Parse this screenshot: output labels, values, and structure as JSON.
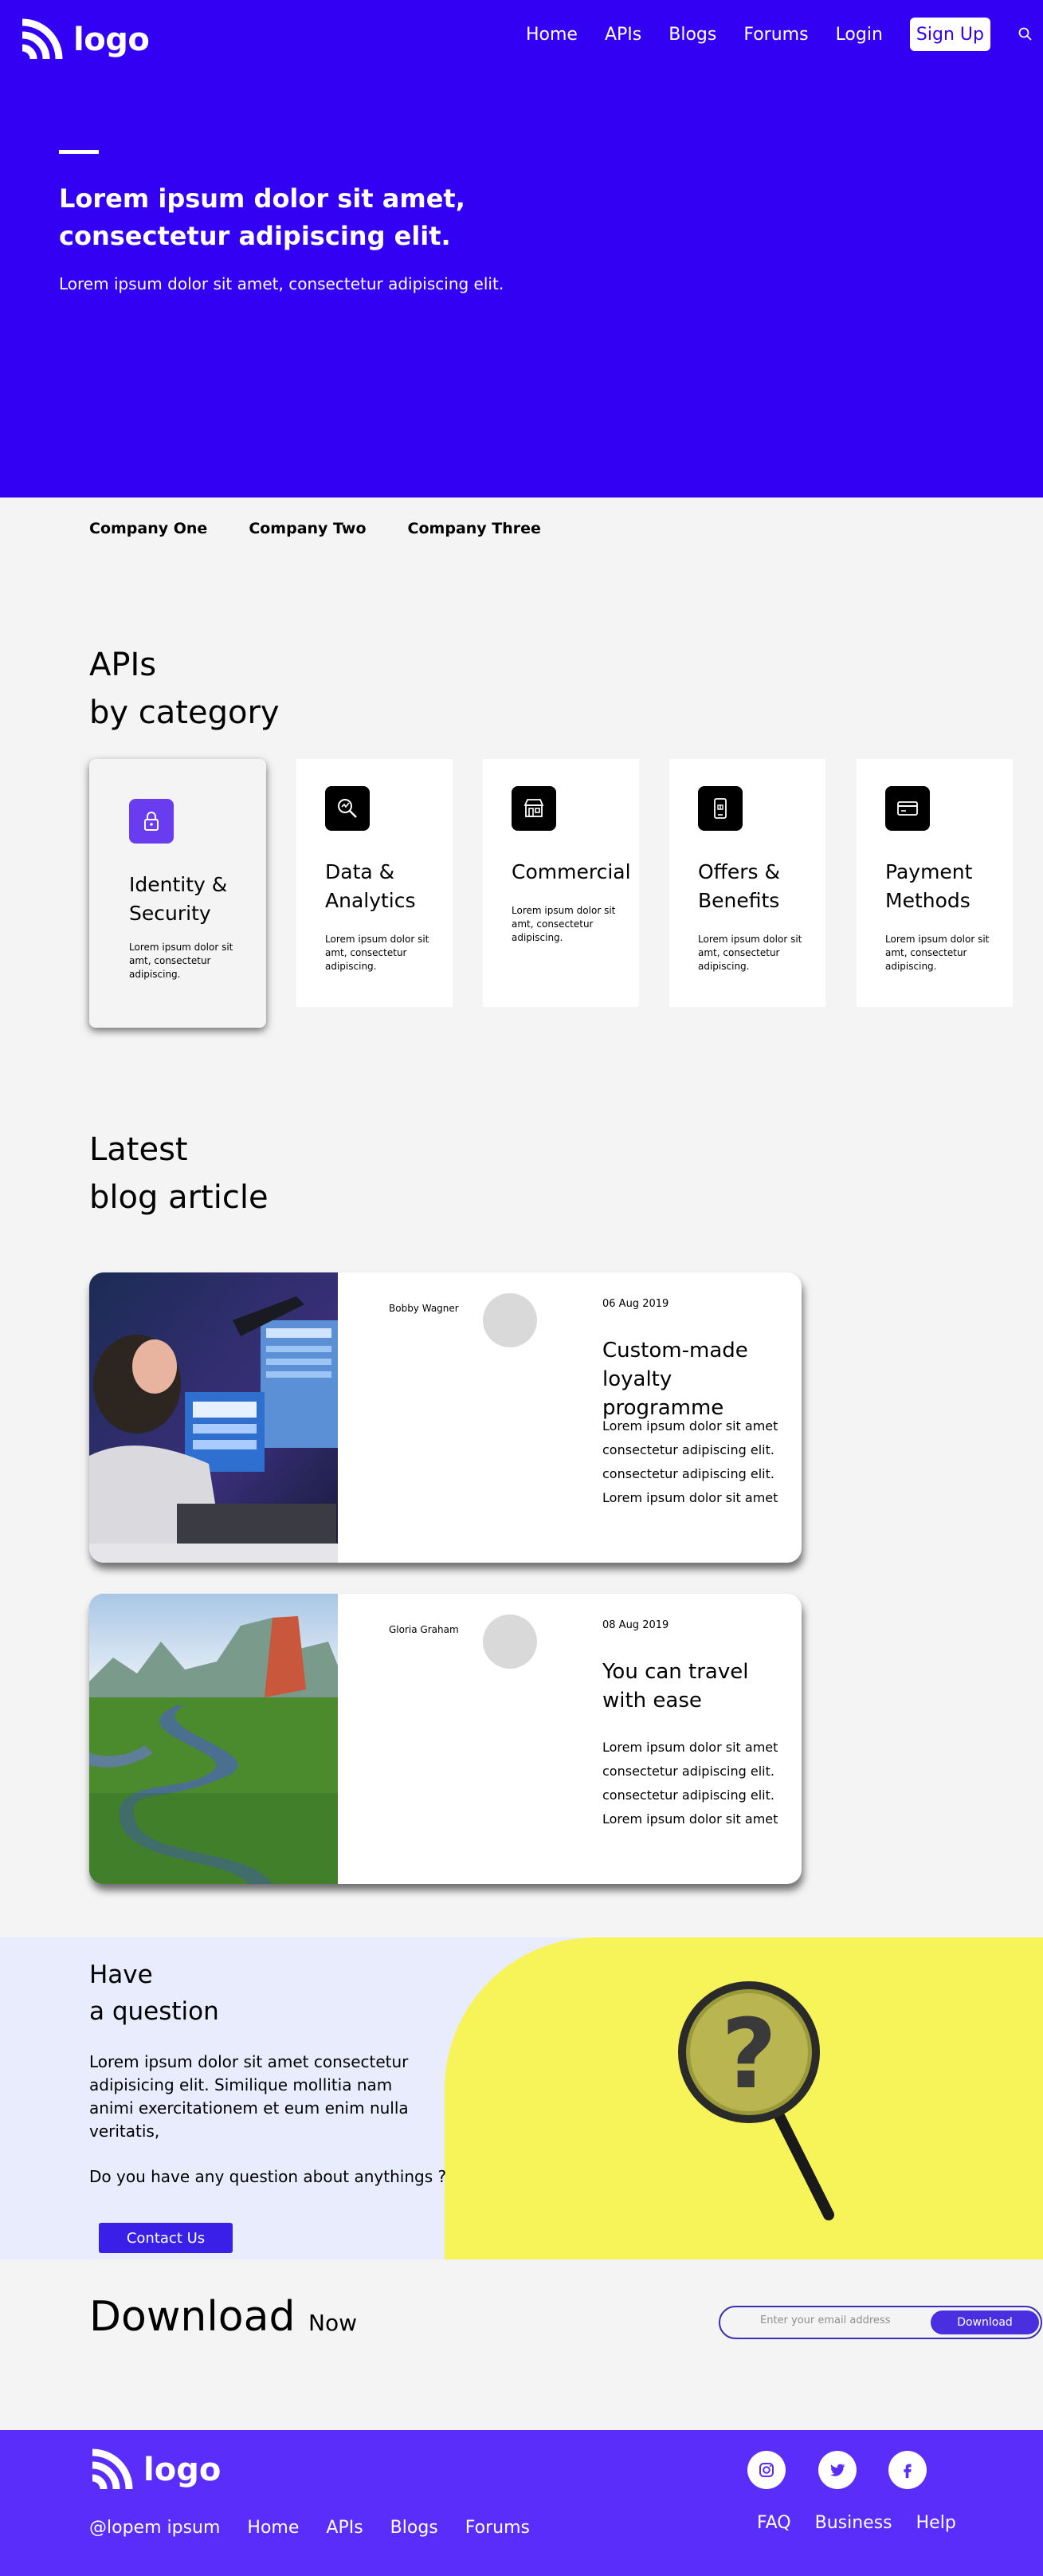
{
  "header": {
    "logo_text": "logo",
    "nav": [
      "Home",
      "APIs",
      "Blogs",
      "Forums",
      "Login"
    ],
    "signup_label": "Sign Up",
    "search_icon": "search-icon"
  },
  "hero": {
    "title": "Lorem ipsum dolor sit amet, consectetur adipiscing elit.",
    "subtitle": "Lorem ipsum dolor sit amet, consectetur adipiscing elit.",
    "background": "#3300f4"
  },
  "companies": [
    "Company One",
    "Company Two",
    "Company Three"
  ],
  "apis": {
    "title_line1": "APIs",
    "title_line2": "by category",
    "cards": [
      {
        "icon": "lock-icon",
        "title": "Identity & Security",
        "desc": "Lorem ipsum dolor sit amt, consectetur adipiscing."
      },
      {
        "icon": "analytics-icon",
        "title": "Data & Analytics",
        "desc": "Lorem ipsum dolor sit amt, consectetur adipiscing."
      },
      {
        "icon": "store-icon",
        "title": "Commercial",
        "desc": "Lorem ipsum dolor sit amt, consectetur adipiscing."
      },
      {
        "icon": "mobile-offer-icon",
        "title": "Offers & Benefits",
        "desc": "Lorem ipsum dolor sit amt, consectetur adipiscing."
      },
      {
        "icon": "credit-card-icon",
        "title": "Payment Methods",
        "desc": "Lorem ipsum dolor sit amt, consectetur adipiscing."
      }
    ]
  },
  "blog": {
    "title_line1": "Latest",
    "title_line2": "blog article",
    "articles": [
      {
        "author": "Bobby Wagner",
        "date": "06 Aug 2019",
        "title": "Custom-made loyalty programme",
        "body": "Lorem ipsum dolor sit amet consectetur adipiscing elit. consectetur adipiscing elit. Lorem ipsum dolor sit amet",
        "image": "person at computer screens"
      },
      {
        "author": "Gloria Graham",
        "date": "08 Aug 2019",
        "title": "You can travel with ease",
        "body": "Lorem ipsum dolor sit amet consectetur adipiscing elit. consectetur adipiscing elit. Lorem ipsum dolor sit amet",
        "image": "winding river through forest"
      }
    ]
  },
  "question": {
    "title_line1": "Have",
    "title_line2": "a question",
    "body": "Lorem ipsum dolor sit amet consectetur adipisicing elit. Similique mollitia nam animi exercitationem et eum enim nulla veritatis,",
    "ask": "Do you have any question about anythings ?",
    "contact_label": "Contact Us",
    "image": "magnifying-glass-question-icon"
  },
  "download": {
    "title": "Download",
    "title_small": "Now",
    "placeholder": "Enter your email address",
    "button_label": "Download"
  },
  "footer": {
    "logo_text": "logo",
    "links": [
      "@lopem ipsum",
      "Home",
      "APIs",
      "Blogs",
      "Forums"
    ],
    "right_links": [
      "FAQ",
      "Business",
      "Help"
    ],
    "social": [
      "instagram-icon",
      "twitter-icon",
      "facebook-icon"
    ],
    "background": "#5a2dfa"
  }
}
